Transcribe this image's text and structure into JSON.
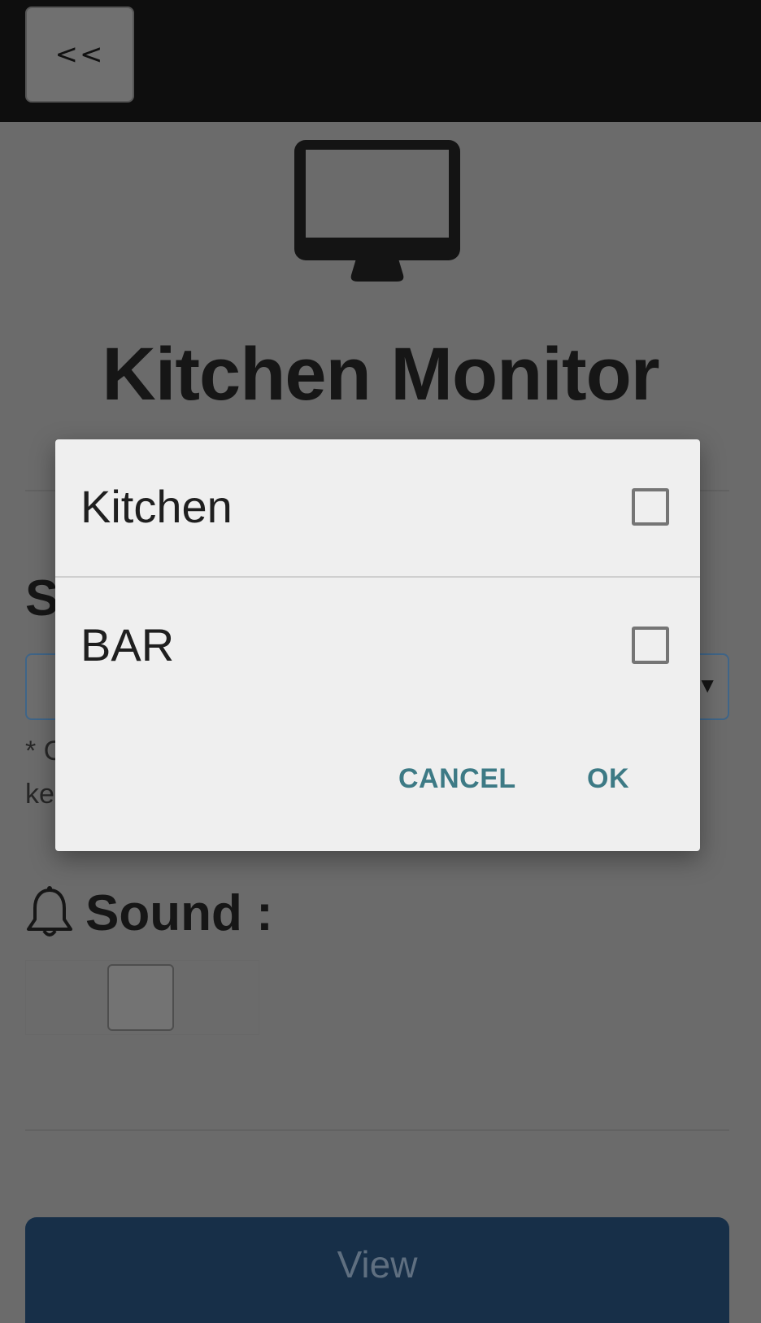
{
  "topbar": {
    "back_label": "<<"
  },
  "page": {
    "title": "Kitchen Monitor",
    "station_heading_visible": "S",
    "select_arrow": "▼",
    "note_line1_visible": "* C",
    "note_line2_visible": "ke",
    "sound_label": "Sound :",
    "view_label": "View"
  },
  "icons": {
    "monitor": "desktop-monitor-icon",
    "bell": "bell-icon"
  },
  "dialog": {
    "items": [
      {
        "label": "Kitchen",
        "checked": false
      },
      {
        "label": "BAR",
        "checked": false
      }
    ],
    "cancel_label": "CANCEL",
    "ok_label": "OK"
  },
  "colors": {
    "topbar": "#0e0e0e",
    "overlay_bg": "#6b6b6b",
    "dialog_bg": "#efefef",
    "dialog_button_text": "#3d7a85",
    "view_button_bg": "#172f48",
    "select_border": "#3f6588"
  }
}
